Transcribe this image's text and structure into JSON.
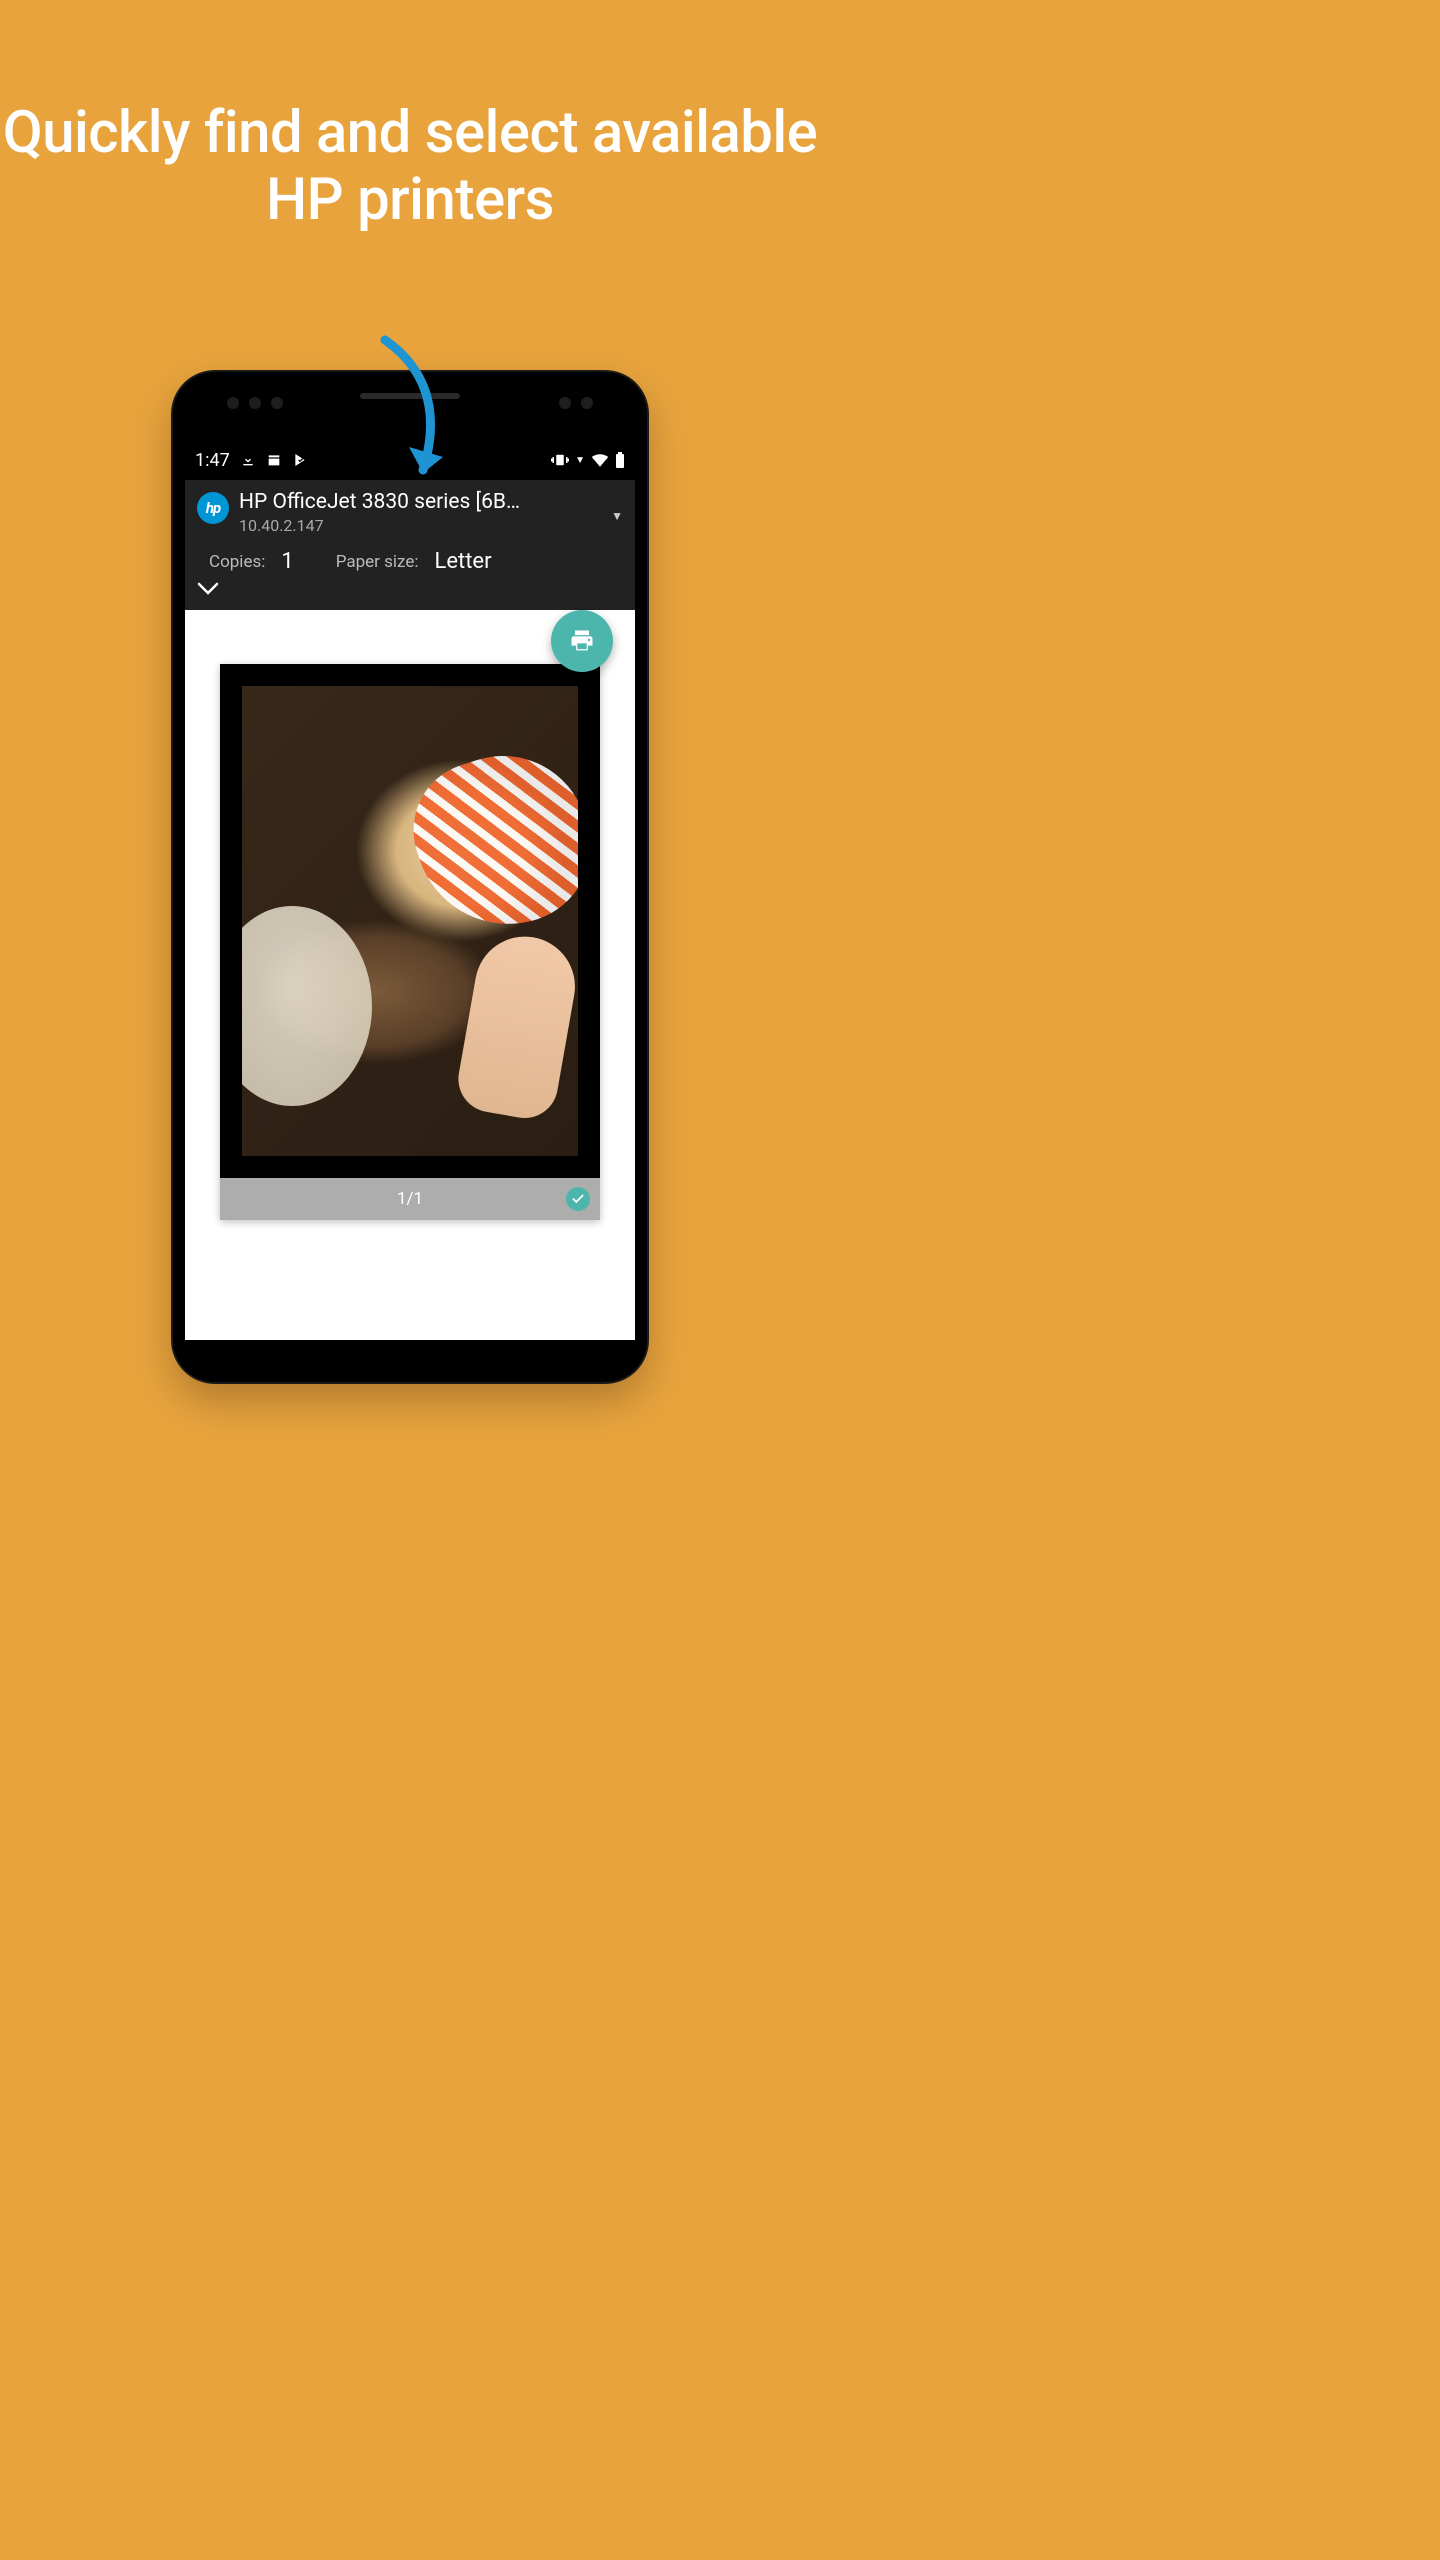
{
  "headline": "Quickly find and select available HP printers",
  "statusbar": {
    "time": "1:47"
  },
  "printer": {
    "logo_text": "hp",
    "name": "HP OfficeJet 3830 series [6B…",
    "ip": "10.40.2.147"
  },
  "options": {
    "copies_label": "Copies:",
    "copies_value": "1",
    "paper_label": "Paper size:",
    "paper_value": "Letter"
  },
  "preview": {
    "page_indicator": "1/1"
  }
}
